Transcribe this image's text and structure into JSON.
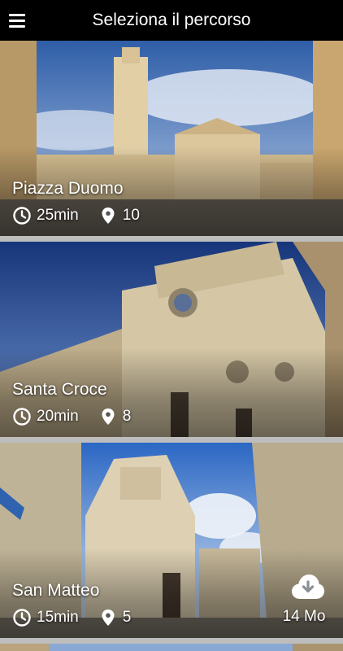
{
  "header": {
    "title": "Seleziona il percorso",
    "menu_icon": "hamburger-menu-icon"
  },
  "routes": [
    {
      "name": "Piazza Duomo",
      "duration": "25min",
      "stops": "10",
      "duration_icon": "clock-icon",
      "stops_icon": "location-pin-icon",
      "colors": {
        "sky_top": "#3f6db5",
        "sky_bottom": "#a9c2e6",
        "stone": "#d8c29a",
        "ground": "#7b7368"
      }
    },
    {
      "name": "Santa Croce",
      "duration": "20min",
      "stops": "8",
      "duration_icon": "clock-icon",
      "stops_icon": "location-pin-icon",
      "colors": {
        "sky_top": "#1d3e8a",
        "sky_bottom": "#5f86c8",
        "stone": "#cfc2a4",
        "ground": "#5b5448"
      }
    },
    {
      "name": "San Matteo",
      "duration": "15min",
      "stops": "5",
      "duration_icon": "clock-icon",
      "stops_icon": "location-pin-icon",
      "download_icon": "cloud-download-icon",
      "download_size": "14 Mo",
      "colors": {
        "sky_top": "#2f6cc7",
        "sky_bottom": "#d9e6f3",
        "stone": "#d6c9ad",
        "ground": "#8a8378"
      }
    }
  ]
}
